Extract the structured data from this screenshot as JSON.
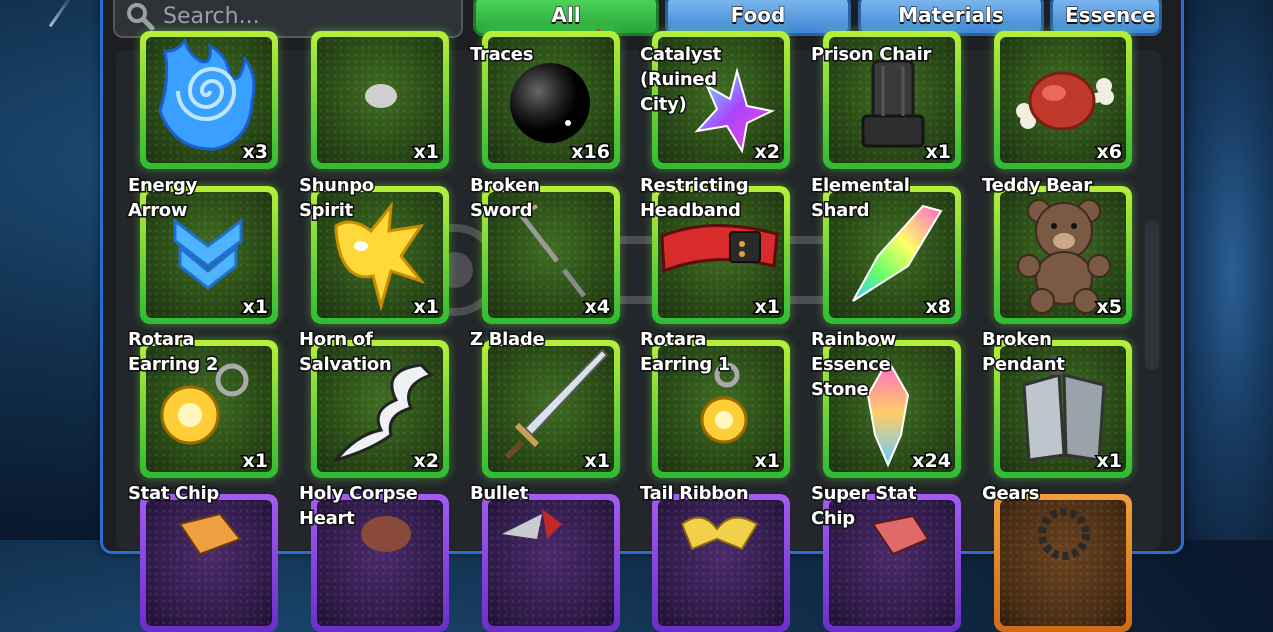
{
  "search": {
    "placeholder": "Search..."
  },
  "tabs": [
    {
      "label": "All",
      "active": true
    },
    {
      "label": "Food",
      "active": false
    },
    {
      "label": "Materials",
      "active": false
    },
    {
      "label": "Essence S",
      "active": false
    }
  ],
  "colors": {
    "active_tab": "#3fc84f",
    "inactive_tab": "#5aa0e6",
    "panel_border": "#2a6fd0",
    "card_rim": "#7cdc35"
  },
  "rows": [
    {
      "items": [
        {
          "name": "",
          "qty": "x3",
          "icon": "blue-swirl-flame-icon"
        },
        {
          "name": "",
          "qty": "x1",
          "icon": "grey-blob-icon"
        },
        {
          "name": "Traces",
          "qty": "x16",
          "icon": "dark-sphere-icon"
        },
        {
          "name": "Catalyst\n(Ruined\nCity)",
          "qty": "x2",
          "icon": "crystal-star-icon"
        },
        {
          "name": "Prison Chair",
          "qty": "x1",
          "icon": "dark-chair-icon"
        },
        {
          "name": "",
          "qty": "x6",
          "icon": "meat-bone-icon"
        }
      ]
    },
    {
      "items": [
        {
          "name": "Energy\nArrow",
          "qty": "x1",
          "icon": "blue-chevron-arrow-icon"
        },
        {
          "name": "Shunpo\nSpirit",
          "qty": "x1",
          "icon": "yellow-lightning-spirit-icon"
        },
        {
          "name": "Broken\nSword",
          "qty": "x4",
          "icon": "broken-sword-icon"
        },
        {
          "name": "Restricting\nHeadband",
          "qty": "x1",
          "icon": "red-headband-icon"
        },
        {
          "name": "Elemental\nShard",
          "qty": "x8",
          "icon": "rainbow-shard-icon"
        },
        {
          "name": "Teddy Bear",
          "qty": "x5",
          "icon": "teddy-bear-icon"
        }
      ]
    },
    {
      "items": [
        {
          "name": "Rotara\nEarring 2",
          "qty": "x1",
          "icon": "gold-earring-icon"
        },
        {
          "name": "Horn of\nSalvation",
          "qty": "x2",
          "icon": "white-horn-icon"
        },
        {
          "name": "Z Blade",
          "qty": "x1",
          "icon": "steel-blade-icon"
        },
        {
          "name": "Rotara\nEarring 1",
          "qty": "x1",
          "icon": "gold-earring-icon"
        },
        {
          "name": "Rainbow\nEssence\nStone",
          "qty": "x24",
          "icon": "rainbow-stone-icon"
        },
        {
          "name": "Broken\nPendant",
          "qty": "x1",
          "icon": "broken-pendant-icon"
        }
      ]
    },
    {
      "items": [
        {
          "name": "Stat Chip",
          "qty": "",
          "icon": "stat-chip-icon"
        },
        {
          "name": "Holy Corpse\nHeart",
          "qty": "",
          "icon": "corpse-heart-icon"
        },
        {
          "name": "Bullet",
          "qty": "",
          "icon": "bullet-icon"
        },
        {
          "name": "Tail Ribbon",
          "qty": "",
          "icon": "tail-ribbon-icon"
        },
        {
          "name": "Super Stat\nChip",
          "qty": "",
          "icon": "super-stat-chip-icon"
        },
        {
          "name": "Gears",
          "qty": "",
          "icon": "gears-icon"
        }
      ]
    }
  ]
}
